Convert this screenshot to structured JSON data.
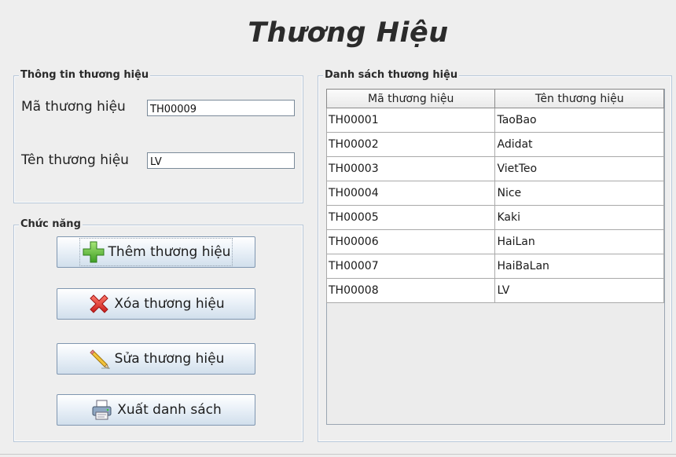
{
  "title": "Thương Hiệu",
  "info_group": {
    "label": "Thông tin thương hiệu",
    "code_label": "Mã thương hiệu",
    "code_value": "TH00009",
    "name_label": "Tên thương hiệu",
    "name_value": "LV"
  },
  "functions_group": {
    "label": "Chức năng",
    "buttons": [
      {
        "label": "Thêm thương hiệu",
        "icon": "plus-icon"
      },
      {
        "label": "Xóa thương hiệu",
        "icon": "delete-x-icon"
      },
      {
        "label": "Sửa thương hiệu",
        "icon": "pencil-icon"
      },
      {
        "label": "Xuất danh sách",
        "icon": "printer-icon"
      }
    ]
  },
  "list_group": {
    "label": "Danh sách thương hiệu",
    "columns": [
      "Mã thương hiệu",
      "Tên thương hiệu"
    ],
    "rows": [
      [
        "TH00001",
        "TaoBao"
      ],
      [
        "TH00002",
        "Adidat"
      ],
      [
        "TH00003",
        "VietTeo"
      ],
      [
        "TH00004",
        "Nice"
      ],
      [
        "TH00005",
        "Kaki"
      ],
      [
        "TH00006",
        "HaiLan"
      ],
      [
        "TH00007",
        "HaiBaLan"
      ],
      [
        "TH00008",
        "LV"
      ]
    ]
  },
  "colors": {
    "background": "#eeeeee",
    "group_border": "#b7c7d9",
    "button_top": "#ffffff",
    "button_bottom": "#d1dfec",
    "plus_green": "#5fc23c",
    "delete_red": "#e0302e"
  }
}
